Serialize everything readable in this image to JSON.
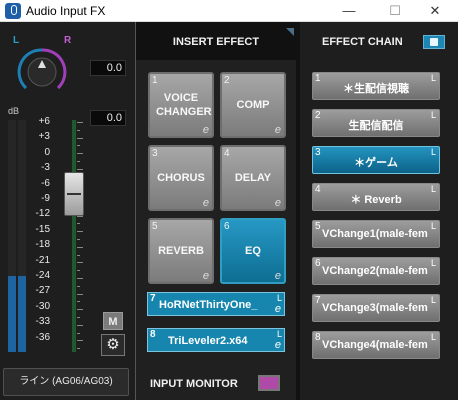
{
  "window": {
    "title": "Audio Input FX",
    "minimize": "—",
    "maximize": "☐",
    "close": "✕"
  },
  "left": {
    "ch_l": "L",
    "ch_r": "R",
    "value1": "0.0",
    "value2": "0.0",
    "db_label": "dB",
    "scale": [
      "+6",
      "+3",
      "0",
      "-3",
      "-6",
      "-9",
      "-12",
      "-15",
      "-18",
      "-21",
      "-24",
      "-27",
      "-30",
      "-33",
      "-36"
    ],
    "mute_label": "M",
    "settings_icon": "gear-icon",
    "source": "ライン (AG06/AG03)"
  },
  "insert": {
    "header": "INSERT EFFECT",
    "slots": [
      {
        "num": "1",
        "label": "VOICE CHANGER",
        "e": "e"
      },
      {
        "num": "2",
        "label": "COMP",
        "e": "e"
      },
      {
        "num": "3",
        "label": "CHORUS",
        "e": "e"
      },
      {
        "num": "4",
        "label": "DELAY",
        "e": "e"
      },
      {
        "num": "5",
        "label": "REVERB",
        "e": "e"
      },
      {
        "num": "6",
        "label": "EQ",
        "e": "e"
      }
    ],
    "wide": [
      {
        "num": "7",
        "label": "HoRNetThirtyOne_",
        "L": "L",
        "e": "e"
      },
      {
        "num": "8",
        "label": "TriLeveler2.x64",
        "L": "L",
        "e": "e"
      }
    ],
    "input_monitor": "INPUT MONITOR"
  },
  "chain": {
    "header": "EFFECT CHAIN",
    "items": [
      {
        "num": "1",
        "label": "＊生配信視聴",
        "L": "L"
      },
      {
        "num": "2",
        "label": "生配信配信",
        "L": "L"
      },
      {
        "num": "3",
        "label": "＊ゲーム",
        "L": "L"
      },
      {
        "num": "4",
        "label": "＊ Reverb",
        "L": "L"
      },
      {
        "num": "5",
        "label": "VChange1(male-fem",
        "L": "L"
      },
      {
        "num": "6",
        "label": "VChange2(male-fem",
        "L": "L"
      },
      {
        "num": "7",
        "label": "VChange3(male-fem",
        "L": "L"
      },
      {
        "num": "8",
        "label": "VChange4(male-fem",
        "L": "L"
      }
    ]
  },
  "colors": {
    "accent": "#1686ae",
    "purple": "#b04aa8",
    "gray_slot": "#8e8e8e"
  }
}
